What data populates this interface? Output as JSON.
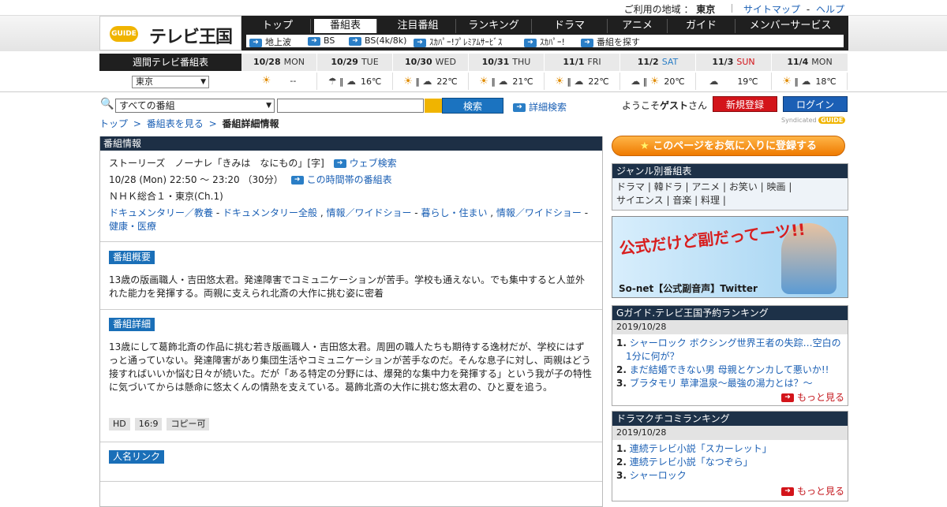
{
  "topbar": {
    "region_label": "ご利用の地域 ：",
    "region_value": "東京",
    "sitemap": "サイトマップ",
    "sep": "-",
    "help": "ヘルプ"
  },
  "logo": {
    "g": "GUIDE",
    "title": "テレビ王国"
  },
  "gnav": {
    "items": [
      "トップ",
      "番組表",
      "注目番組",
      "ランキング",
      "ドラマ",
      "アニメ",
      "ガイド",
      "メンバーサービス"
    ],
    "active": 1
  },
  "subnav": {
    "items": [
      "地上波",
      "BS",
      "BS(4k/8k)",
      "ｽｶﾊﾟｰ!ﾌﾟﾚﾐｱﾑｻｰﾋﾞｽ",
      "ｽｶﾊﾟｰ!",
      "番組を探す"
    ]
  },
  "weekly": {
    "title": "週間テレビ番組表",
    "region": "東京"
  },
  "days": [
    {
      "date": "10/28",
      "dow": "MON",
      "color": "#333",
      "w1": "sun",
      "w2": "",
      "temp": "--"
    },
    {
      "date": "10/29",
      "dow": "TUE",
      "color": "#333",
      "w1": "umbrella",
      "w2": "cloud",
      "temp": "16℃"
    },
    {
      "date": "10/30",
      "dow": "WED",
      "color": "#333",
      "w1": "sun",
      "w2": "cloud",
      "temp": "22℃"
    },
    {
      "date": "10/31",
      "dow": "THU",
      "color": "#333",
      "w1": "sun",
      "w2": "cloud",
      "temp": "21℃"
    },
    {
      "date": "11/1",
      "dow": "FRI",
      "color": "#333",
      "w1": "sun",
      "w2": "cloud",
      "temp": "22℃"
    },
    {
      "date": "11/2",
      "dow": "SAT",
      "color": "#2a7ec6",
      "w1": "cloud",
      "w2": "sun",
      "temp": "20℃"
    },
    {
      "date": "11/3",
      "dow": "SUN",
      "color": "#d3141a",
      "w1": "cloud",
      "w2": "",
      "temp": "19℃"
    },
    {
      "date": "11/4",
      "dow": "MON",
      "color": "#333",
      "w1": "sun",
      "w2": "cloud",
      "temp": "18℃"
    }
  ],
  "search": {
    "category": "すべての番組",
    "button": "検索",
    "advanced": "詳細検索"
  },
  "user": {
    "welcome_pre": "ようこそ",
    "welcome_name": "ゲスト",
    "welcome_post": "さん",
    "register": "新規登録",
    "login": "ログイン",
    "syndicated": "Syndicated"
  },
  "breadcrumb": {
    "top": "トップ",
    "listing": "番組表を見る",
    "current": "番組詳細情報",
    "sep": ">"
  },
  "program": {
    "panel_title": "番組情報",
    "title": "ストーリーズ　ノーナレ「きみは　なにもの」[字]",
    "web_search": "ウェブ検索",
    "time": "10/28 (Mon) 22:50 ～ 23:20 （30分）",
    "timeslot_link": "この時間帯の番組表",
    "channel": "ＮＨＫ総合１・東京(Ch.1)",
    "genres": [
      "ドキュメンタリー／教養",
      "ドキュメンタリー全般",
      "情報／ワイドショー",
      "暮らし・住まい",
      "情報／ワイドショー",
      "健康・医療"
    ],
    "summary_label": "番組概要",
    "summary": "13歳の版画職人・吉田悠太君。発達障害でコミュニケーションが苦手。学校も通えない。でも集中すると人並外れた能力を発揮する。両親に支えられ北斎の大作に挑む姿に密着",
    "detail_label": "番組詳細",
    "detail": "13歳にして葛飾北斎の作品に挑む若き版画職人・吉田悠太君。周囲の職人たちも期待する逸材だが、学校にはずっと通っていない。発達障害があり集団生活やコミュニケーションが苦手なのだ。そんな息子に対し、両親はどう接すればいいか悩む日々が続いた。だが「ある特定の分野には、爆発的な集中力を発揮する」という我が子の特性に気づいてからは懸命に悠太くんの情熱を支えている。葛飾北斎の大作に挑む悠太君の、ひと夏を追う。",
    "badges": [
      "HD",
      "16:9",
      "コピー可"
    ],
    "people_label": "人名リンク"
  },
  "side": {
    "favorite": "このページをお気に入りに登録する",
    "genre_title": "ジャンル別番組表",
    "genres": [
      "ドラマ",
      "韓ドラ",
      "アニメ",
      "お笑い",
      "映画",
      "サイエンス",
      "音楽",
      "料理"
    ],
    "banner_text": "公式だけど副だってーツ!!",
    "banner_caption": "So-net【公式副音声】Twitter",
    "rank1_title": "Gガイド.テレビ王国予約ランキング",
    "rank1_date": "2019/10/28",
    "rank1": [
      "シャーロック ボクシング世界王者の失踪…空白の1分に何が？",
      "まだ結婚できない男 母親とケンカして悪いか!!",
      "ブラタモリ 草津温泉〜最強の湯力とは？〜"
    ],
    "rank2_title": "ドラマクチコミランキング",
    "rank2_date": "2019/10/28",
    "rank2": [
      "連続テレビ小説「スカーレット」",
      "連続テレビ小説「なつぞら」",
      "シャーロック"
    ],
    "more": "もっと見る"
  }
}
